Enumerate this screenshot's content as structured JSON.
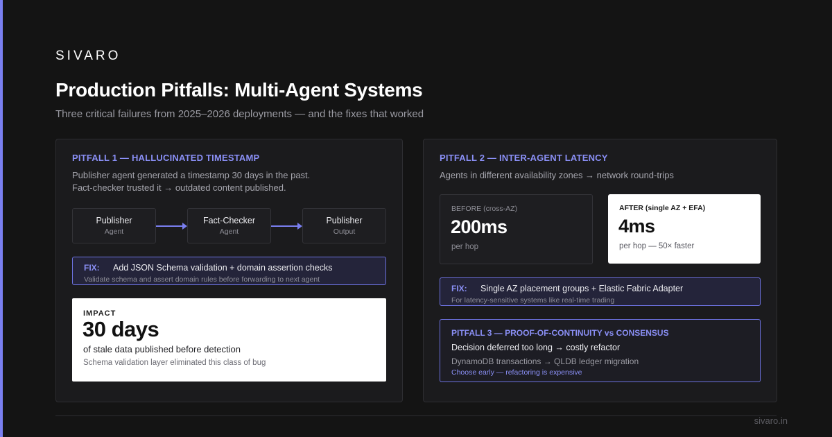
{
  "brand": "SIVARO",
  "title": "Production Pitfalls: Multi-Agent Systems",
  "subtitle": "Three critical failures from 2025–2026 deployments — and the fixes that worked",
  "colors": {
    "accent": "#7a7ff0",
    "background": "#141414",
    "card": "#1b1b1d",
    "white_panel": "#ffffff"
  },
  "pitfall1": {
    "heading": "PITFALL 1 — HALLUCINATED TIMESTAMP",
    "desc_line1": "Publisher agent generated a timestamp 30 days in the past.",
    "desc_line2": "Fact-checker trusted it → outdated content published.",
    "flow": [
      {
        "title": "Publisher",
        "sub": "Agent"
      },
      {
        "title": "Fact-Checker",
        "sub": "Agent"
      },
      {
        "title": "Publisher",
        "sub": "Output"
      }
    ],
    "fix": {
      "label": "FIX:",
      "text": "Add JSON Schema validation + domain assertion checks",
      "sub": "Validate schema and assert domain rules before forwarding to next agent"
    },
    "impact": {
      "label": "IMPACT",
      "value": "30 days",
      "desc": "of stale data published before detection",
      "note": "Schema validation layer eliminated this class of bug"
    }
  },
  "pitfall2": {
    "heading": "PITFALL 2 — INTER-AGENT LATENCY",
    "desc": "Agents in different availability zones → network round-trips",
    "before": {
      "label": "BEFORE (cross-AZ)",
      "value": "200ms",
      "sub": "per hop"
    },
    "after": {
      "label": "AFTER (single AZ + EFA)",
      "value": "4ms",
      "sub": "per hop — 50× faster"
    },
    "fix": {
      "label": "FIX:",
      "text": "Single AZ placement groups + Elastic Fabric Adapter",
      "sub": "For latency-sensitive systems like real-time trading"
    }
  },
  "pitfall3": {
    "heading": "PITFALL 3 — PROOF-OF-CONTINUITY vs CONSENSUS",
    "line1": "Decision deferred too long → costly refactor",
    "line2": "DynamoDB transactions → QLDB ledger migration",
    "line3": "Choose early — refactoring is expensive"
  },
  "footer": "sivaro.in"
}
